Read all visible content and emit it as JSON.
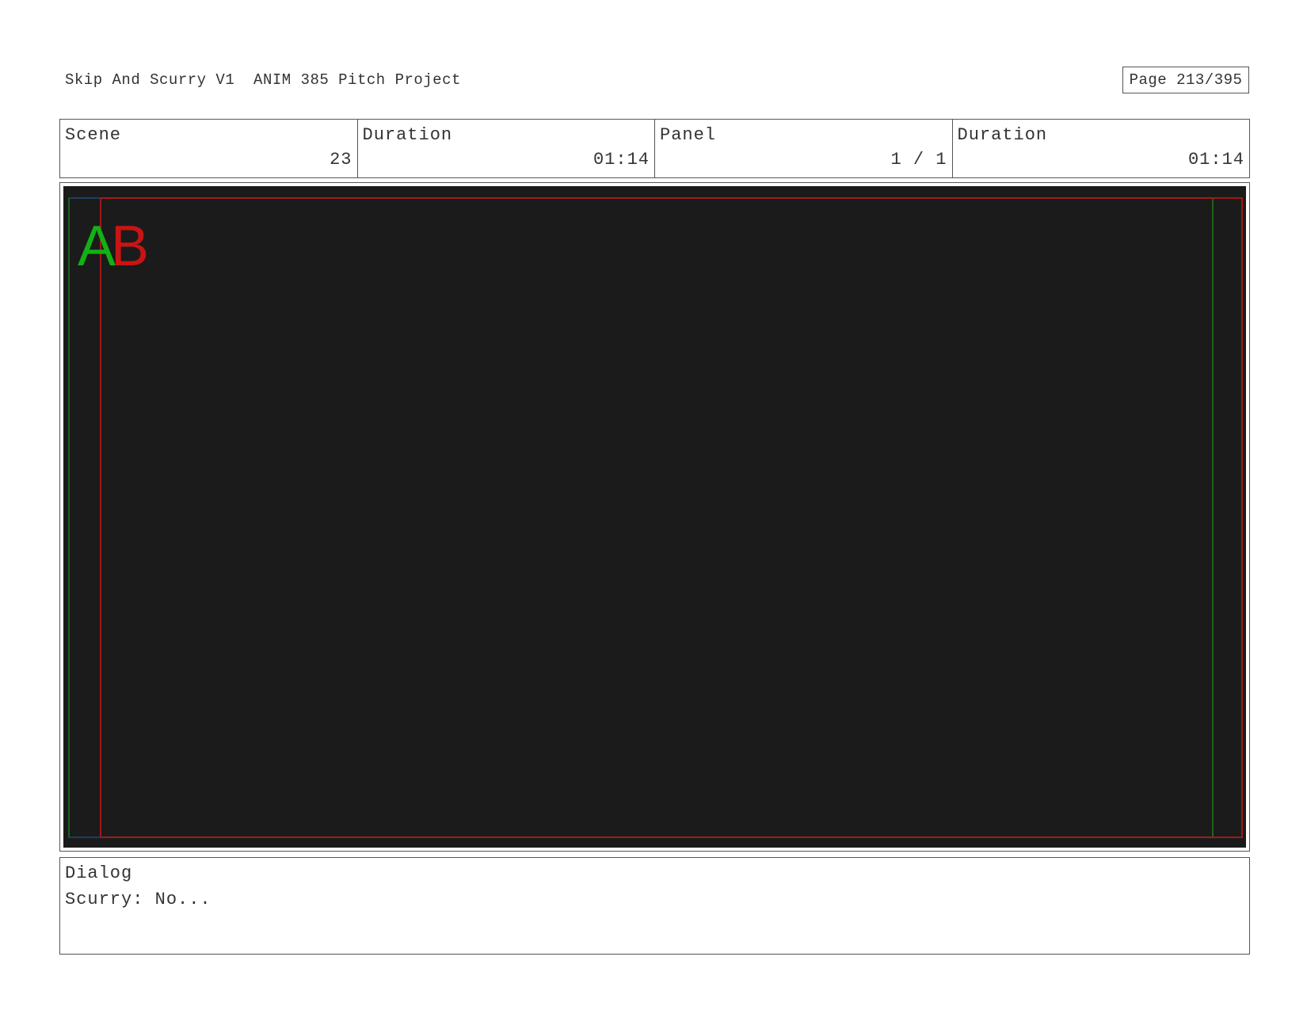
{
  "header": {
    "title": "Skip And Scurry V1  ANIM 385 Pitch Project",
    "page": "Page 213/395"
  },
  "info": {
    "scene_label": "Scene",
    "scene_value": "23",
    "scene_duration_label": "Duration",
    "scene_duration_value": "01:14",
    "panel_label": "Panel",
    "panel_value": "1 / 1",
    "panel_duration_label": "Duration",
    "panel_duration_value": "01:14"
  },
  "panel": {
    "background_color": "#1b1b1b",
    "marker_a": "A",
    "marker_b": "B",
    "marker_a_color": "#14b014",
    "marker_b_color": "#c81414",
    "guide_colors": {
      "green": "#1e7a1e",
      "red": "#b01818",
      "blue": "#1e3a7a"
    }
  },
  "dialog": {
    "label": "Dialog",
    "text": "Scurry: No..."
  }
}
